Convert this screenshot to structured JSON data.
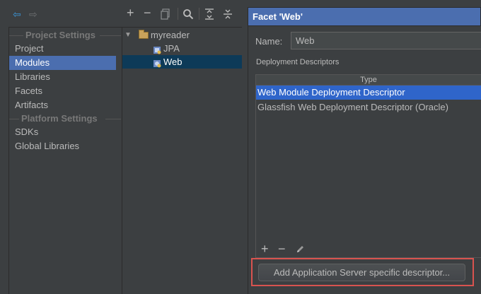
{
  "nav": {
    "back_icon": "arrow-left-icon",
    "forward_icon": "arrow-right-icon"
  },
  "sidebar": {
    "project_settings_header": "Project Settings",
    "project_items": [
      {
        "label": "Project",
        "selected": false
      },
      {
        "label": "Modules",
        "selected": true
      },
      {
        "label": "Libraries",
        "selected": false
      },
      {
        "label": "Facets",
        "selected": false
      },
      {
        "label": "Artifacts",
        "selected": false
      }
    ],
    "platform_settings_header": "Platform Settings",
    "platform_items": [
      {
        "label": "SDKs",
        "selected": false
      },
      {
        "label": "Global Libraries",
        "selected": false
      }
    ]
  },
  "tree": {
    "toolbar_icons": [
      "plus-icon",
      "minus-icon",
      "copy-icon",
      "search-icon",
      "expand-all-icon",
      "collapse-all-icon"
    ],
    "root": {
      "label": "myreader",
      "expanded": true
    },
    "children": [
      {
        "label": "JPA",
        "selected": false
      },
      {
        "label": "Web",
        "selected": true
      }
    ]
  },
  "facet": {
    "header": "Facet 'Web'",
    "name_label": "Name:",
    "name_value": "Web",
    "deployment_descriptors_label": "Deployment Descriptors",
    "table_header": "Type",
    "descriptors": [
      {
        "label": "Web Module Deployment Descriptor",
        "selected": true
      },
      {
        "label": "Glassfish Web Deployment Descriptor (Oracle)",
        "selected": false
      }
    ],
    "table_toolbar_icons": [
      "plus-icon",
      "minus-icon",
      "edit-icon"
    ],
    "add_button_label": "Add Application Server specific descriptor..."
  },
  "colors": {
    "selection_sidebar": "#4b6eaf",
    "selection_tree": "#0d3a58",
    "selection_table": "#2f65ca",
    "highlight_box": "#d9534f",
    "background": "#3c3f41"
  }
}
